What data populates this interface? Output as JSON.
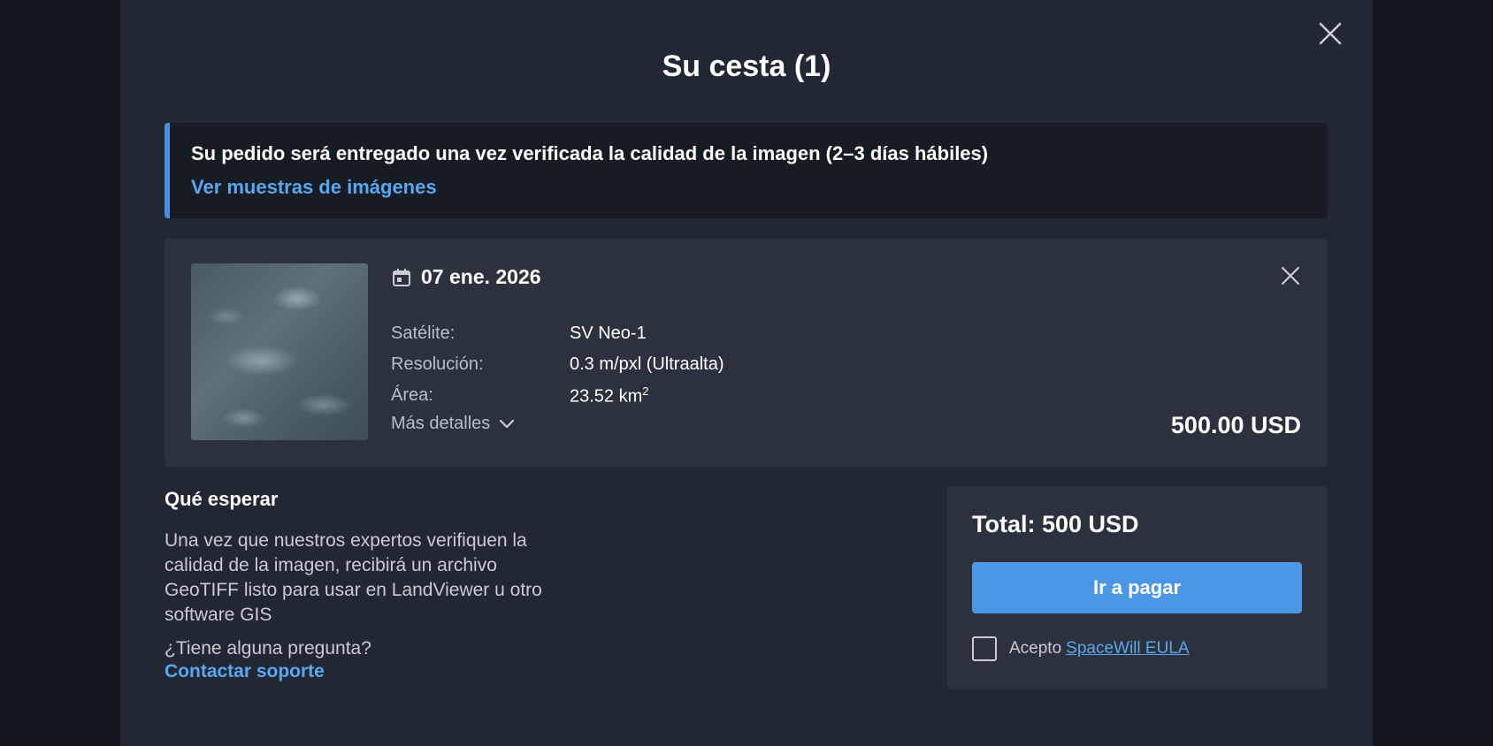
{
  "modal": {
    "title": "Su cesta (1)",
    "close_icon": "close-icon"
  },
  "notice": {
    "text": "Su pedido será entregado una vez verificada la calidad de la imagen (2–3 días hábiles)",
    "link": "Ver muestras de imágenes",
    "accent_color": "#4a90e2"
  },
  "item": {
    "date": "07 ene. 2026",
    "date_icon": "calendar-icon",
    "specs": {
      "satellite_label": "Satélite:",
      "satellite_value": "SV Neo-1",
      "resolution_label": "Resolución:",
      "resolution_value": "0.3 m/pxl (Ultraalta)",
      "area_label": "Área:",
      "area_value": "23.52 km",
      "area_unit_power": "2"
    },
    "more_details": "Más detalles",
    "price": "500.00 USD"
  },
  "expect": {
    "title": "Qué esperar",
    "text": "Una vez que nuestros expertos verifiquen la calidad de la imagen, recibirá un archivo GeoTIFF listo para usar en LandViewer u otro software GIS",
    "question": "¿Tiene alguna pregunta?",
    "support_link": "Contactar soporte"
  },
  "summary": {
    "total": "Total: 500 USD",
    "pay_button": "Ir a pagar",
    "accept_text": "Acepto",
    "eula_link": "SpaceWill EULA",
    "button_color": "#4b97e6"
  }
}
